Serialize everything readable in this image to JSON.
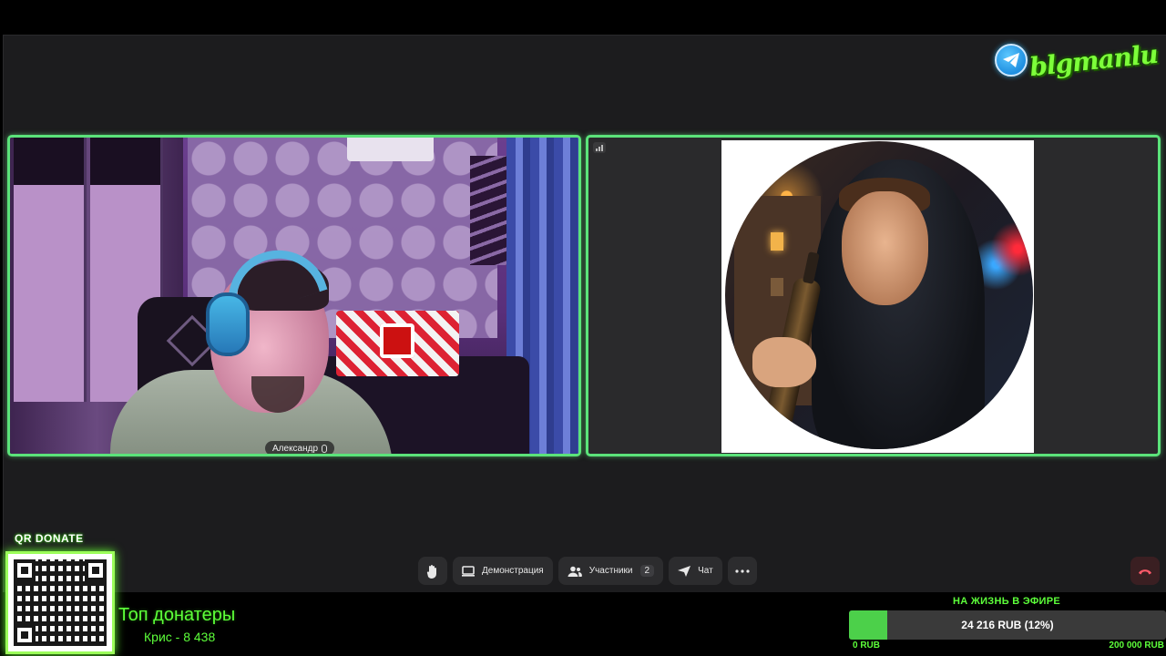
{
  "logo": {
    "text": "blgmanlu",
    "icon": "telegram-icon"
  },
  "participants": [
    {
      "name": "Александр",
      "mic_icon": "microphone-icon",
      "active_speaker": true
    },
    {
      "avatar": "hooded-man-avatar",
      "signal_icon": "signal-bars-icon"
    }
  ],
  "controls": {
    "raise_hand_icon": "hand-icon",
    "demo_label": "Демонстрация",
    "participants_label": "Участники",
    "participants_count": "2",
    "chat_label": "Чат",
    "more_icon": "more-dots-icon",
    "end_call_icon": "end-call-icon"
  },
  "overlay": {
    "qr_label": "QR DONATE",
    "donors_title": "Топ донатеры",
    "top_donor": "Крис - 8 438",
    "goal_title": "НА ЖИЗНЬ В ЭФИРЕ",
    "goal_text": "24 216 RUB (12%)",
    "goal_progress": 0.12,
    "goal_min": "0 RUB",
    "goal_max": "200 000 RUB"
  },
  "colors": {
    "accent_green": "#5be37a",
    "overlay_green": "#5dff3a",
    "app_bg": "#1c1c1e",
    "control_bg": "#2c2c2e"
  }
}
